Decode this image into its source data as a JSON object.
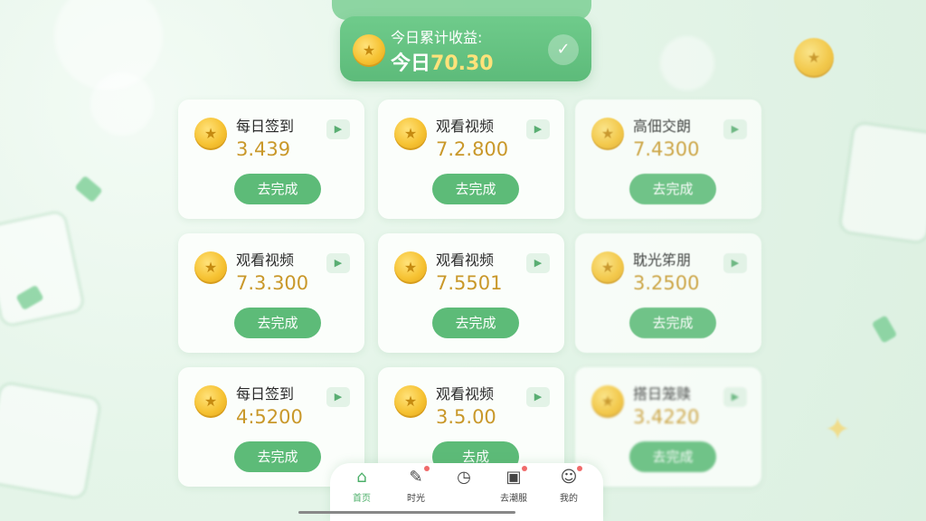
{
  "colors": {
    "accent": "#5dbb78",
    "value": "#c9982a",
    "bg": "#e5f5e9"
  },
  "summary": {
    "title": "今日累计收益:",
    "value_prefix": "今日",
    "value_amount": "70.30",
    "check_icon": "check-icon"
  },
  "cards": [
    {
      "title": "每日签到",
      "value": "3.439",
      "button": "去完成"
    },
    {
      "title": "观看视频",
      "value": "7.2.800",
      "button": "去完成"
    },
    {
      "title": "高佃交朗",
      "value": "7.4300",
      "button": "去完成"
    },
    {
      "title": "观看视频",
      "value": "7.3.300",
      "button": "去完成"
    },
    {
      "title": "观看视频",
      "value": "7.5501",
      "button": "去完成"
    },
    {
      "title": "耽光笫朋",
      "value": "3.2500",
      "button": "去完成"
    },
    {
      "title": "每日签到",
      "value": "4:5200",
      "button": "去完成"
    },
    {
      "title": "观看视频",
      "value": "3.5.00",
      "button": "去成"
    },
    {
      "title": "搭日笼赎",
      "value": "3.4220",
      "button": "去完成"
    }
  ],
  "nav": [
    {
      "label": "首页",
      "icon": "home-icon"
    },
    {
      "label": "时光",
      "icon": "edit-icon"
    },
    {
      "label": "",
      "icon": "clock-icon"
    },
    {
      "label": "去潮服",
      "icon": "image-icon"
    },
    {
      "label": "我的",
      "icon": "user-icon"
    }
  ]
}
